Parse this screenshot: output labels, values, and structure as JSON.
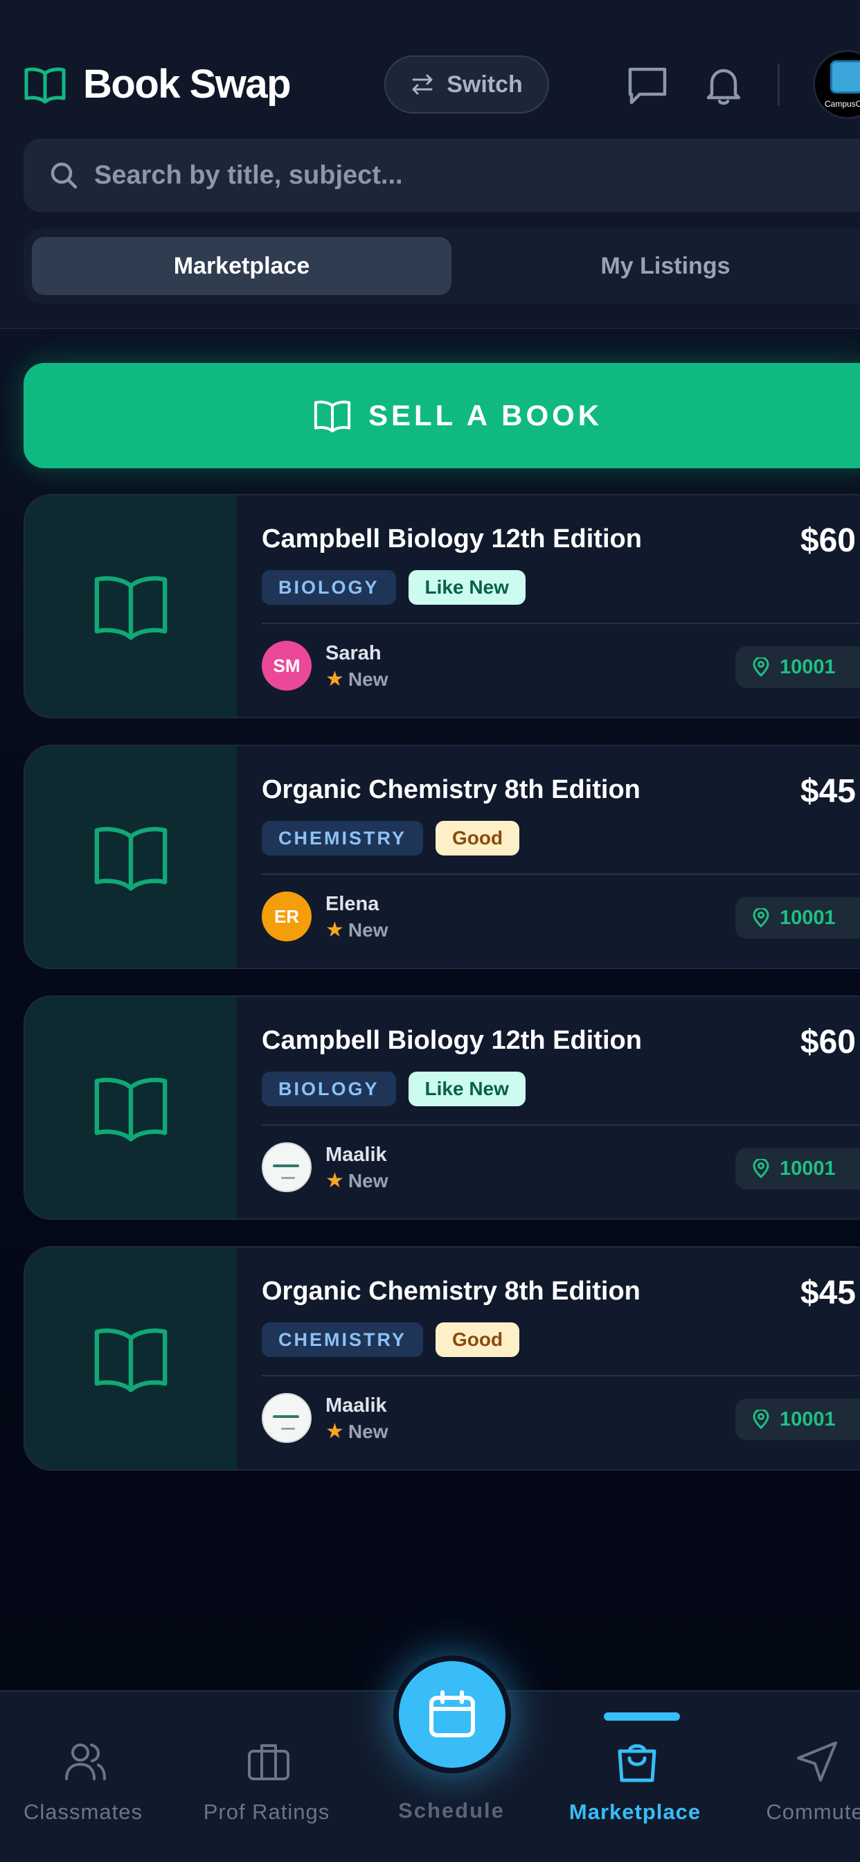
{
  "header": {
    "title": "Book Swap",
    "switch_label": "Switch",
    "app_badge_caption": "CampusCo"
  },
  "search": {
    "placeholder": "Search by title, subject..."
  },
  "tabs": [
    {
      "label": "Marketplace",
      "active": true
    },
    {
      "label": "My Listings",
      "active": false
    }
  ],
  "sell_button": {
    "label": "SELL A BOOK"
  },
  "listings": [
    {
      "title": "Campbell Biology 12th Edition",
      "price": "$60",
      "subject": "BIOLOGY",
      "condition": "Like New",
      "seller": {
        "initials": "SM",
        "name": "Sarah",
        "rating": "New",
        "avatar_color": "#ec4899"
      },
      "zip": "10001"
    },
    {
      "title": "Organic Chemistry 8th Edition",
      "price": "$45",
      "subject": "CHEMISTRY",
      "condition": "Good",
      "seller": {
        "initials": "ER",
        "name": "Elena",
        "rating": "New",
        "avatar_color": "#f59e0b"
      },
      "zip": "10001"
    },
    {
      "title": "Campbell Biology 12th Edition",
      "price": "$60",
      "subject": "BIOLOGY",
      "condition": "Like New",
      "seller": {
        "initials": "",
        "name": "Maalik",
        "rating": "New",
        "avatar_color": "#f4f6f6"
      },
      "zip": "10001"
    },
    {
      "title": "Organic Chemistry 8th Edition",
      "price": "$45",
      "subject": "CHEMISTRY",
      "condition": "Good",
      "seller": {
        "initials": "",
        "name": "Maalik",
        "rating": "New",
        "avatar_color": "#f4f6f6"
      },
      "zip": "10001"
    }
  ],
  "bottom_nav": [
    {
      "label": "Classmates",
      "icon": "users-icon"
    },
    {
      "label": "Prof Ratings",
      "icon": "briefcase-icon"
    },
    {
      "label": "Schedule",
      "icon": "calendar-icon"
    },
    {
      "label": "Marketplace",
      "icon": "shopping-bag-icon",
      "active": true
    },
    {
      "label": "Commute",
      "icon": "navigation-icon"
    }
  ],
  "colors": {
    "accent_green": "#10b981",
    "accent_blue": "#38bdf8",
    "background": "#0f1729"
  }
}
